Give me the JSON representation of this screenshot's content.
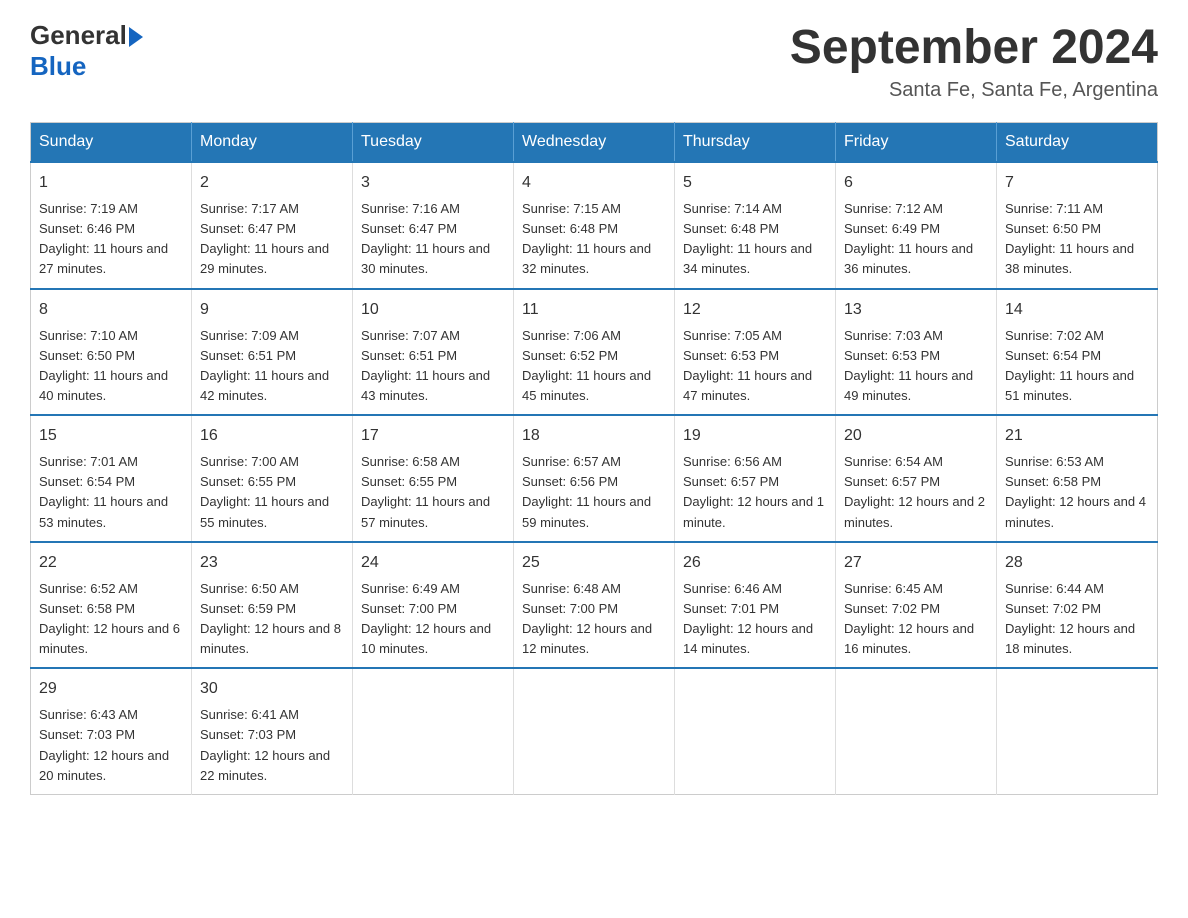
{
  "header": {
    "logo": {
      "general_text": "General",
      "blue_text": "Blue"
    },
    "title": "September 2024",
    "location": "Santa Fe, Santa Fe, Argentina"
  },
  "calendar": {
    "days_of_week": [
      "Sunday",
      "Monday",
      "Tuesday",
      "Wednesday",
      "Thursday",
      "Friday",
      "Saturday"
    ],
    "weeks": [
      [
        {
          "day": "1",
          "sunrise": "Sunrise: 7:19 AM",
          "sunset": "Sunset: 6:46 PM",
          "daylight": "Daylight: 11 hours and 27 minutes."
        },
        {
          "day": "2",
          "sunrise": "Sunrise: 7:17 AM",
          "sunset": "Sunset: 6:47 PM",
          "daylight": "Daylight: 11 hours and 29 minutes."
        },
        {
          "day": "3",
          "sunrise": "Sunrise: 7:16 AM",
          "sunset": "Sunset: 6:47 PM",
          "daylight": "Daylight: 11 hours and 30 minutes."
        },
        {
          "day": "4",
          "sunrise": "Sunrise: 7:15 AM",
          "sunset": "Sunset: 6:48 PM",
          "daylight": "Daylight: 11 hours and 32 minutes."
        },
        {
          "day": "5",
          "sunrise": "Sunrise: 7:14 AM",
          "sunset": "Sunset: 6:48 PM",
          "daylight": "Daylight: 11 hours and 34 minutes."
        },
        {
          "day": "6",
          "sunrise": "Sunrise: 7:12 AM",
          "sunset": "Sunset: 6:49 PM",
          "daylight": "Daylight: 11 hours and 36 minutes."
        },
        {
          "day": "7",
          "sunrise": "Sunrise: 7:11 AM",
          "sunset": "Sunset: 6:50 PM",
          "daylight": "Daylight: 11 hours and 38 minutes."
        }
      ],
      [
        {
          "day": "8",
          "sunrise": "Sunrise: 7:10 AM",
          "sunset": "Sunset: 6:50 PM",
          "daylight": "Daylight: 11 hours and 40 minutes."
        },
        {
          "day": "9",
          "sunrise": "Sunrise: 7:09 AM",
          "sunset": "Sunset: 6:51 PM",
          "daylight": "Daylight: 11 hours and 42 minutes."
        },
        {
          "day": "10",
          "sunrise": "Sunrise: 7:07 AM",
          "sunset": "Sunset: 6:51 PM",
          "daylight": "Daylight: 11 hours and 43 minutes."
        },
        {
          "day": "11",
          "sunrise": "Sunrise: 7:06 AM",
          "sunset": "Sunset: 6:52 PM",
          "daylight": "Daylight: 11 hours and 45 minutes."
        },
        {
          "day": "12",
          "sunrise": "Sunrise: 7:05 AM",
          "sunset": "Sunset: 6:53 PM",
          "daylight": "Daylight: 11 hours and 47 minutes."
        },
        {
          "day": "13",
          "sunrise": "Sunrise: 7:03 AM",
          "sunset": "Sunset: 6:53 PM",
          "daylight": "Daylight: 11 hours and 49 minutes."
        },
        {
          "day": "14",
          "sunrise": "Sunrise: 7:02 AM",
          "sunset": "Sunset: 6:54 PM",
          "daylight": "Daylight: 11 hours and 51 minutes."
        }
      ],
      [
        {
          "day": "15",
          "sunrise": "Sunrise: 7:01 AM",
          "sunset": "Sunset: 6:54 PM",
          "daylight": "Daylight: 11 hours and 53 minutes."
        },
        {
          "day": "16",
          "sunrise": "Sunrise: 7:00 AM",
          "sunset": "Sunset: 6:55 PM",
          "daylight": "Daylight: 11 hours and 55 minutes."
        },
        {
          "day": "17",
          "sunrise": "Sunrise: 6:58 AM",
          "sunset": "Sunset: 6:55 PM",
          "daylight": "Daylight: 11 hours and 57 minutes."
        },
        {
          "day": "18",
          "sunrise": "Sunrise: 6:57 AM",
          "sunset": "Sunset: 6:56 PM",
          "daylight": "Daylight: 11 hours and 59 minutes."
        },
        {
          "day": "19",
          "sunrise": "Sunrise: 6:56 AM",
          "sunset": "Sunset: 6:57 PM",
          "daylight": "Daylight: 12 hours and 1 minute."
        },
        {
          "day": "20",
          "sunrise": "Sunrise: 6:54 AM",
          "sunset": "Sunset: 6:57 PM",
          "daylight": "Daylight: 12 hours and 2 minutes."
        },
        {
          "day": "21",
          "sunrise": "Sunrise: 6:53 AM",
          "sunset": "Sunset: 6:58 PM",
          "daylight": "Daylight: 12 hours and 4 minutes."
        }
      ],
      [
        {
          "day": "22",
          "sunrise": "Sunrise: 6:52 AM",
          "sunset": "Sunset: 6:58 PM",
          "daylight": "Daylight: 12 hours and 6 minutes."
        },
        {
          "day": "23",
          "sunrise": "Sunrise: 6:50 AM",
          "sunset": "Sunset: 6:59 PM",
          "daylight": "Daylight: 12 hours and 8 minutes."
        },
        {
          "day": "24",
          "sunrise": "Sunrise: 6:49 AM",
          "sunset": "Sunset: 7:00 PM",
          "daylight": "Daylight: 12 hours and 10 minutes."
        },
        {
          "day": "25",
          "sunrise": "Sunrise: 6:48 AM",
          "sunset": "Sunset: 7:00 PM",
          "daylight": "Daylight: 12 hours and 12 minutes."
        },
        {
          "day": "26",
          "sunrise": "Sunrise: 6:46 AM",
          "sunset": "Sunset: 7:01 PM",
          "daylight": "Daylight: 12 hours and 14 minutes."
        },
        {
          "day": "27",
          "sunrise": "Sunrise: 6:45 AM",
          "sunset": "Sunset: 7:02 PM",
          "daylight": "Daylight: 12 hours and 16 minutes."
        },
        {
          "day": "28",
          "sunrise": "Sunrise: 6:44 AM",
          "sunset": "Sunset: 7:02 PM",
          "daylight": "Daylight: 12 hours and 18 minutes."
        }
      ],
      [
        {
          "day": "29",
          "sunrise": "Sunrise: 6:43 AM",
          "sunset": "Sunset: 7:03 PM",
          "daylight": "Daylight: 12 hours and 20 minutes."
        },
        {
          "day": "30",
          "sunrise": "Sunrise: 6:41 AM",
          "sunset": "Sunset: 7:03 PM",
          "daylight": "Daylight: 12 hours and 22 minutes."
        },
        null,
        null,
        null,
        null,
        null
      ]
    ]
  }
}
